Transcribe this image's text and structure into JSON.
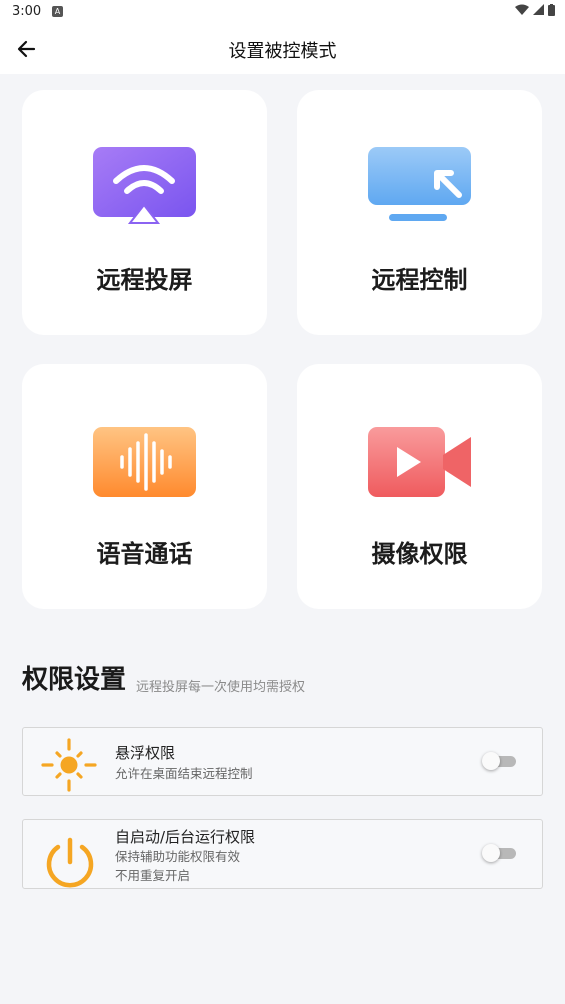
{
  "status_bar": {
    "time": "3:00"
  },
  "app_bar": {
    "title": "设置被控模式"
  },
  "cards": [
    {
      "label": "远程投屏",
      "icon": "screen-cast-icon"
    },
    {
      "label": "远程控制",
      "icon": "remote-control-icon"
    },
    {
      "label": "语音通话",
      "icon": "voice-call-icon"
    },
    {
      "label": "摄像权限",
      "icon": "camera-icon"
    }
  ],
  "permissions": {
    "title": "权限设置",
    "subtitle": "远程投屏每一次使用均需授权",
    "items": [
      {
        "title": "悬浮权限",
        "desc": "允许在桌面结束远程控制",
        "icon": "sun-icon",
        "enabled": false
      },
      {
        "title": "自启动/后台运行权限",
        "desc": "保持辅助功能权限有效",
        "desc2": "不用重复开启",
        "icon": "power-icon",
        "enabled": false
      }
    ]
  },
  "colors": {
    "background": "#f4f5f8",
    "card": "#ffffff",
    "cast_purple": "#8b63f2",
    "control_blue": "#6fb2f3",
    "voice_orange": "#ff9d45",
    "camera_red": "#f36a6c",
    "permission_orange": "#f5a623"
  }
}
